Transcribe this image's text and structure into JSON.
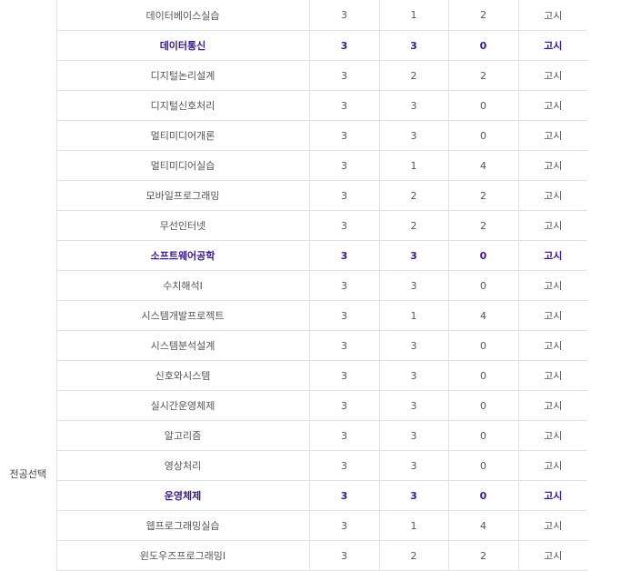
{
  "category_label": "전공선택",
  "rows": [
    {
      "name": "데이터베이스실습",
      "credit": "3",
      "theory": "1",
      "practice": "2",
      "type": "고시",
      "highlight": false
    },
    {
      "name": "데이터통신",
      "credit": "3",
      "theory": "3",
      "practice": "0",
      "type": "고시",
      "highlight": true
    },
    {
      "name": "디지털논리설계",
      "credit": "3",
      "theory": "2",
      "practice": "2",
      "type": "고시",
      "highlight": false
    },
    {
      "name": "디지털신호처리",
      "credit": "3",
      "theory": "3",
      "practice": "0",
      "type": "고시",
      "highlight": false
    },
    {
      "name": "멀티미디어개론",
      "credit": "3",
      "theory": "3",
      "practice": "0",
      "type": "고시",
      "highlight": false
    },
    {
      "name": "멀티미디어실습",
      "credit": "3",
      "theory": "1",
      "practice": "4",
      "type": "고시",
      "highlight": false
    },
    {
      "name": "모바일프로그래밍",
      "credit": "3",
      "theory": "2",
      "practice": "2",
      "type": "고시",
      "highlight": false
    },
    {
      "name": "무선인터넷",
      "credit": "3",
      "theory": "2",
      "practice": "2",
      "type": "고시",
      "highlight": false
    },
    {
      "name": "소프트웨어공학",
      "credit": "3",
      "theory": "3",
      "practice": "0",
      "type": "고시",
      "highlight": true
    },
    {
      "name": "수치해석Ⅰ",
      "credit": "3",
      "theory": "3",
      "practice": "0",
      "type": "고시",
      "highlight": false
    },
    {
      "name": "시스템개발프로젝트",
      "credit": "3",
      "theory": "1",
      "practice": "4",
      "type": "고시",
      "highlight": false
    },
    {
      "name": "시스템분석설계",
      "credit": "3",
      "theory": "3",
      "practice": "0",
      "type": "고시",
      "highlight": false
    },
    {
      "name": "신호와시스템",
      "credit": "3",
      "theory": "3",
      "practice": "0",
      "type": "고시",
      "highlight": false
    },
    {
      "name": "실시간운영체제",
      "credit": "3",
      "theory": "3",
      "practice": "0",
      "type": "고시",
      "highlight": false
    },
    {
      "name": "알고리즘",
      "credit": "3",
      "theory": "3",
      "practice": "0",
      "type": "고시",
      "highlight": false
    },
    {
      "name": "영상처리",
      "credit": "3",
      "theory": "3",
      "practice": "0",
      "type": "고시",
      "highlight": false
    },
    {
      "name": "운영체제",
      "credit": "3",
      "theory": "3",
      "practice": "0",
      "type": "고시",
      "highlight": true
    },
    {
      "name": "웹프로그래밍실습",
      "credit": "3",
      "theory": "1",
      "practice": "4",
      "type": "고시",
      "highlight": false
    },
    {
      "name": "윈도우즈프로그래밍Ⅰ",
      "credit": "3",
      "theory": "2",
      "practice": "2",
      "type": "고시",
      "highlight": false
    }
  ]
}
